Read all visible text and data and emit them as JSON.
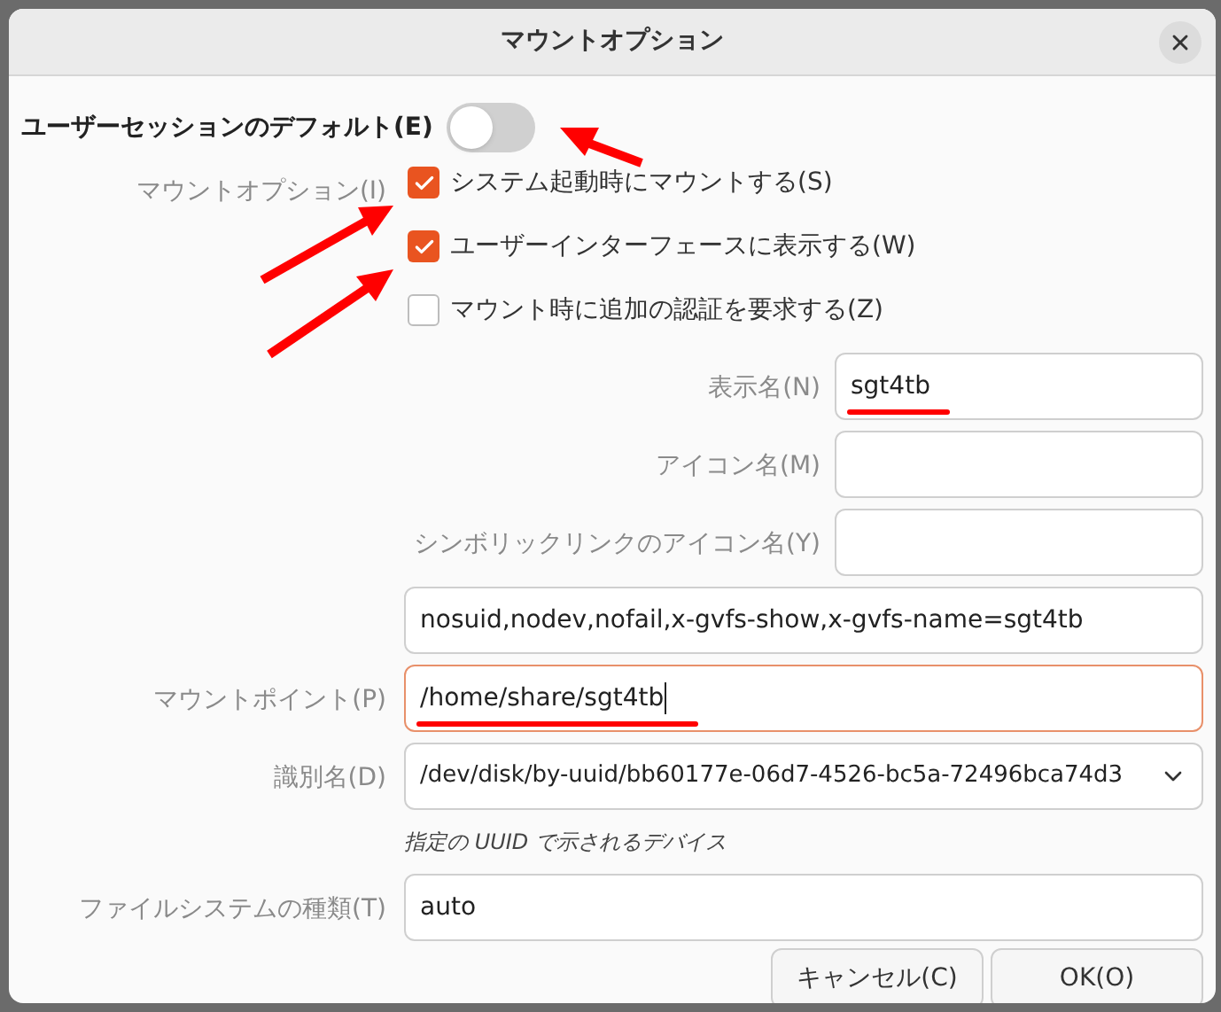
{
  "dialog": {
    "title": "マウントオプション"
  },
  "user_session_default": {
    "label": "ユーザーセッションのデフォルト(E)",
    "on": false
  },
  "mount_options": {
    "label": "マウントオプション(I)",
    "checkboxes": [
      {
        "label": "システム起動時にマウントする(S)",
        "checked": true
      },
      {
        "label": "ユーザーインターフェースに表示する(W)",
        "checked": true
      },
      {
        "label": "マウント時に追加の認証を要求する(Z)",
        "checked": false
      }
    ]
  },
  "short_fields": [
    {
      "label": "表示名(N)",
      "value": "sgt4tb",
      "underlined": true
    },
    {
      "label": "アイコン名(M)",
      "underlined": false
    },
    {
      "label": "シンボリックリンクのアイコン名(Y)",
      "underlined": false
    }
  ],
  "options_field": {
    "value": "nosuid,nodev,nofail,x-gvfs-show,x-gvfs-name=sgt4tb"
  },
  "mount_point": {
    "label": "マウントポイント(P)",
    "value": "/home/share/sgt4tb",
    "focused": true,
    "underlined": true
  },
  "identifier": {
    "label": "識別名(D)",
    "value": "/dev/disk/by-uuid/bb60177e-06d7-4526-bc5a-72496bca74d3",
    "hint": "指定の UUID で示されるデバイス"
  },
  "filesystem_type": {
    "label": "ファイルシステムの種類(T)",
    "value": "auto"
  },
  "buttons": [
    "キャンセル(C)",
    "OK(O)"
  ]
}
